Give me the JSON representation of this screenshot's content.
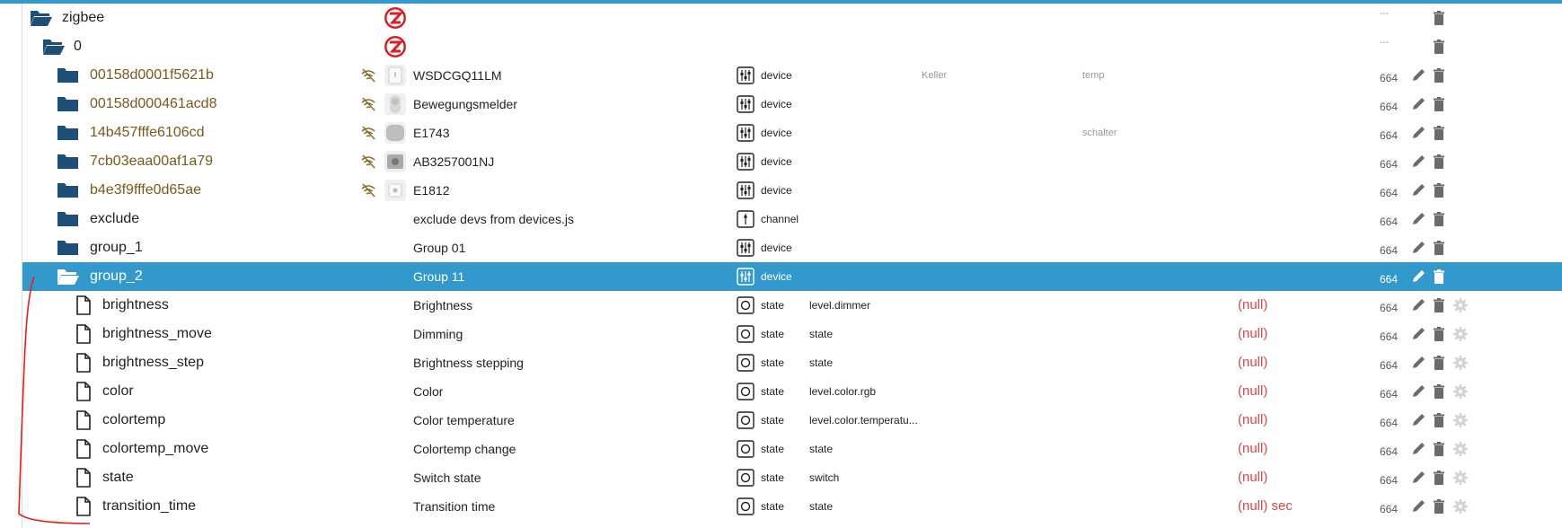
{
  "colors": {
    "accent": "#3399cc",
    "folder": "#1f4e79",
    "null_value": "#e04545",
    "annotation": "#e02020"
  },
  "rows": [
    {
      "name": "zigbee",
      "label": "",
      "type": "",
      "role": "",
      "room": "",
      "function": "",
      "value": "",
      "acl": "---",
      "kind": "folder-open",
      "thumb": "zigbee-logo",
      "wifi": false
    },
    {
      "name": "0",
      "label": "",
      "type": "",
      "role": "",
      "room": "",
      "function": "",
      "value": "",
      "acl": "---",
      "kind": "folder-open",
      "thumb": "zigbee-logo",
      "wifi": false
    },
    {
      "name": "00158d0001f5621b",
      "label": "WSDCGQ11LM",
      "type": "device",
      "role": "",
      "room": "Keller",
      "function": "temp",
      "value": "",
      "acl": "664",
      "kind": "folder",
      "thumb": "sensor",
      "wifi": true
    },
    {
      "name": "00158d000461acd8",
      "label": "Bewegungsmelder",
      "type": "device",
      "role": "",
      "room": "",
      "function": "",
      "value": "",
      "acl": "664",
      "kind": "folder",
      "thumb": "motion",
      "wifi": true
    },
    {
      "name": "14b457fffe6106cd",
      "label": "E1743",
      "type": "device",
      "role": "",
      "room": "",
      "function": "schalter",
      "value": "",
      "acl": "664",
      "kind": "folder",
      "thumb": "remote",
      "wifi": true
    },
    {
      "name": "7cb03eaa00af1a79",
      "label": "AB3257001NJ",
      "type": "device",
      "role": "",
      "room": "",
      "function": "",
      "value": "",
      "acl": "664",
      "kind": "folder",
      "thumb": "plug",
      "wifi": true
    },
    {
      "name": "b4e3f9fffe0d65ae",
      "label": "E1812",
      "type": "device",
      "role": "",
      "room": "",
      "function": "",
      "value": "",
      "acl": "664",
      "kind": "folder",
      "thumb": "button",
      "wifi": true
    },
    {
      "name": "exclude",
      "label": "exclude devs from devices.js",
      "type": "channel",
      "role": "",
      "room": "",
      "function": "",
      "value": "",
      "acl": "664",
      "kind": "folder",
      "thumb": "",
      "wifi": false
    },
    {
      "name": "group_1",
      "label": "Group 01",
      "type": "device",
      "role": "",
      "room": "",
      "function": "",
      "value": "",
      "acl": "664",
      "kind": "folder",
      "thumb": "",
      "wifi": false
    },
    {
      "name": "group_2",
      "label": "Group 11",
      "type": "device",
      "role": "",
      "room": "",
      "function": "",
      "value": "",
      "acl": "664",
      "kind": "folder-open",
      "thumb": "",
      "wifi": false,
      "selected": true
    },
    {
      "name": "brightness",
      "label": "Brightness",
      "type": "state",
      "role": "level.dimmer",
      "room": "",
      "function": "",
      "value": "(null)",
      "acl": "664",
      "kind": "file",
      "thumb": "",
      "wifi": false
    },
    {
      "name": "brightness_move",
      "label": "Dimming",
      "type": "state",
      "role": "state",
      "room": "",
      "function": "",
      "value": "(null)",
      "acl": "664",
      "kind": "file",
      "thumb": "",
      "wifi": false
    },
    {
      "name": "brightness_step",
      "label": "Brightness stepping",
      "type": "state",
      "role": "state",
      "room": "",
      "function": "",
      "value": "(null)",
      "acl": "664",
      "kind": "file",
      "thumb": "",
      "wifi": false
    },
    {
      "name": "color",
      "label": "Color",
      "type": "state",
      "role": "level.color.rgb",
      "room": "",
      "function": "",
      "value": "(null)",
      "acl": "664",
      "kind": "file",
      "thumb": "",
      "wifi": false
    },
    {
      "name": "colortemp",
      "label": "Color temperature",
      "type": "state",
      "role": "level.color.temperatu...",
      "room": "",
      "function": "",
      "value": "(null)",
      "acl": "664",
      "kind": "file",
      "thumb": "",
      "wifi": false
    },
    {
      "name": "colortemp_move",
      "label": "Colortemp change",
      "type": "state",
      "role": "state",
      "room": "",
      "function": "",
      "value": "(null)",
      "acl": "664",
      "kind": "file",
      "thumb": "",
      "wifi": false
    },
    {
      "name": "state",
      "label": "Switch state",
      "type": "state",
      "role": "switch",
      "room": "",
      "function": "",
      "value": "(null)",
      "acl": "664",
      "kind": "file",
      "thumb": "",
      "wifi": false
    },
    {
      "name": "transition_time",
      "label": "Transition time",
      "type": "state",
      "role": "state",
      "room": "",
      "function": "",
      "value": "(null) sec",
      "acl": "664",
      "kind": "file",
      "thumb": "",
      "wifi": false
    }
  ]
}
